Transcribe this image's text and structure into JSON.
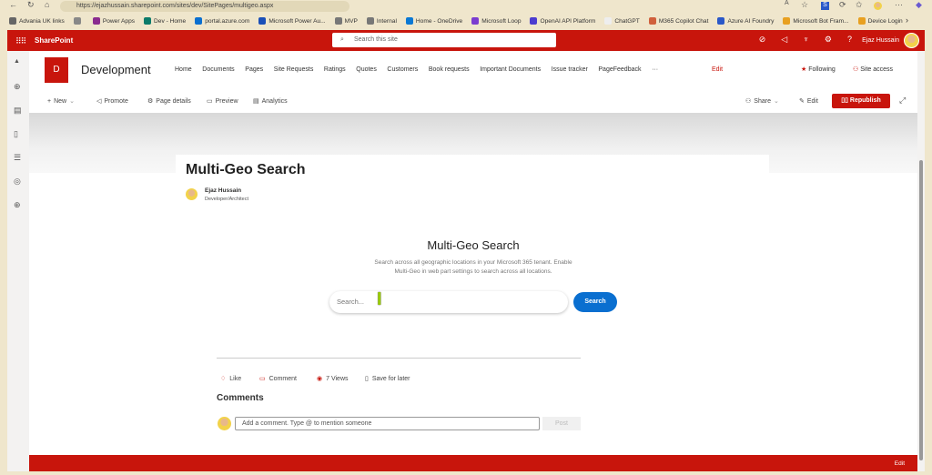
{
  "browser": {
    "url": "https://ejazhussain.sharepoint.com/sites/dev/SitePages/multigeo.aspx",
    "bookmarks": [
      {
        "label": "Advania UK links",
        "color": "#666"
      },
      {
        "label": "",
        "color": "#888"
      },
      {
        "label": "Power Apps",
        "color": "#8a2b8f"
      },
      {
        "label": "Dev - Home",
        "color": "#0b7b6a"
      },
      {
        "label": "portal.azure.com",
        "color": "#0a6fd0"
      },
      {
        "label": "Microsoft Power Au...",
        "color": "#1a4fb8"
      },
      {
        "label": "MVP",
        "color": "#777"
      },
      {
        "label": "Internal",
        "color": "#777"
      },
      {
        "label": "Home - OneDrive",
        "color": "#0a78d4"
      },
      {
        "label": "Microsoft Loop",
        "color": "#7a3cd0"
      },
      {
        "label": "OpenAI API Platform",
        "color": "#4b3cd0"
      },
      {
        "label": "ChatGPT",
        "color": "#eee"
      },
      {
        "label": "M365 Copilot Chat",
        "color": "#d0603c"
      },
      {
        "label": "Azure AI Foundry",
        "color": "#2a58c8"
      },
      {
        "label": "Microsoft Bot Fram...",
        "color": "#e8a020"
      },
      {
        "label": "Device Login",
        "color": "#e8a020"
      }
    ]
  },
  "suite": {
    "brand": "SharePoint",
    "search_placeholder": "Search this site",
    "user": "Ejaz Hussain"
  },
  "site": {
    "logo_letter": "D",
    "title": "Development",
    "nav": [
      "Home",
      "Documents",
      "Pages",
      "Site Requests",
      "Ratings",
      "Quotes",
      "Customers",
      "Book requests",
      "Important Documents",
      "Issue tracker",
      "PageFeedback",
      "···"
    ],
    "nav_edit": "Edit",
    "following": "Following",
    "site_access": "Site access"
  },
  "commands": {
    "new": "New",
    "promote": "Promote",
    "page_details": "Page details",
    "preview": "Preview",
    "analytics": "Analytics",
    "share": "Share",
    "edit": "Edit",
    "republish": "Republish"
  },
  "page": {
    "title": "Multi-Geo Search",
    "author": "Ejaz Hussain",
    "author_role": "Developer/Architect"
  },
  "webpart": {
    "title": "Multi-Geo Search",
    "desc1": "Search across all geographic locations in your Microsoft 365 tenant. Enable",
    "desc2": "Multi-Geo in web part settings to search across all locations.",
    "placeholder": "Search...",
    "button": "Search"
  },
  "social": {
    "like": "Like",
    "comment": "Comment",
    "views": "7 Views",
    "save": "Save for later"
  },
  "comments": {
    "heading": "Comments",
    "placeholder": "Add a comment. Type @ to mention someone",
    "post": "Post"
  },
  "footer": {
    "edit": "Edit"
  }
}
